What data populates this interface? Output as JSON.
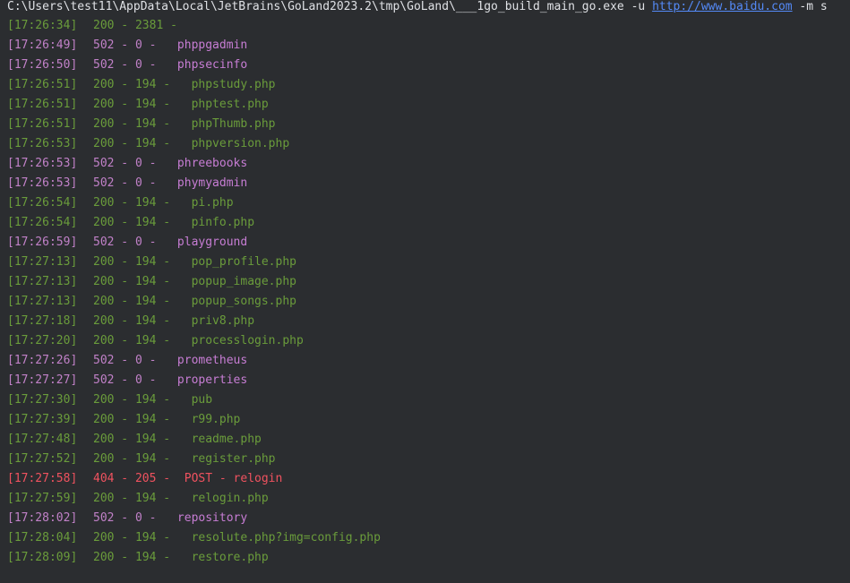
{
  "command": {
    "prefix": "C:\\Users\\test11\\AppData\\Local\\JetBrains\\GoLand2023.2\\tmp\\GoLand\\___1go_build_main_go.exe -u ",
    "url": "http://www.baidu.com",
    "suffix": " -m s"
  },
  "colors": {
    "background": "#2b2d30",
    "ok": "#6a9c3b",
    "bad_gateway": "#c181c8",
    "error": "#f0525f",
    "link": "#548af7"
  },
  "lines": [
    {
      "ts": "[17:26:34]",
      "meta": "200 - 2381 -",
      "path": "",
      "status": "green"
    },
    {
      "ts": "[17:26:49]",
      "meta": "502 - 0 -   ",
      "path": "phppgadmin",
      "status": "purple"
    },
    {
      "ts": "[17:26:50]",
      "meta": "502 - 0 -   ",
      "path": "phpsecinfo",
      "status": "purple"
    },
    {
      "ts": "[17:26:51]",
      "meta": "200 - 194 -   ",
      "path": "phpstudy.php",
      "status": "green"
    },
    {
      "ts": "[17:26:51]",
      "meta": "200 - 194 -   ",
      "path": "phptest.php",
      "status": "green"
    },
    {
      "ts": "[17:26:51]",
      "meta": "200 - 194 -   ",
      "path": "phpThumb.php",
      "status": "green"
    },
    {
      "ts": "[17:26:53]",
      "meta": "200 - 194 -   ",
      "path": "phpversion.php",
      "status": "green"
    },
    {
      "ts": "[17:26:53]",
      "meta": "502 - 0 -   ",
      "path": "phreebooks",
      "status": "purple"
    },
    {
      "ts": "[17:26:53]",
      "meta": "502 - 0 -   ",
      "path": "phymyadmin",
      "status": "purple"
    },
    {
      "ts": "[17:26:54]",
      "meta": "200 - 194 -   ",
      "path": "pi.php",
      "status": "green"
    },
    {
      "ts": "[17:26:54]",
      "meta": "200 - 194 -   ",
      "path": "pinfo.php",
      "status": "green"
    },
    {
      "ts": "[17:26:59]",
      "meta": "502 - 0 -   ",
      "path": "playground",
      "status": "purple"
    },
    {
      "ts": "[17:27:13]",
      "meta": "200 - 194 -   ",
      "path": "pop_profile.php",
      "status": "green"
    },
    {
      "ts": "[17:27:13]",
      "meta": "200 - 194 -   ",
      "path": "popup_image.php",
      "status": "green"
    },
    {
      "ts": "[17:27:13]",
      "meta": "200 - 194 -   ",
      "path": "popup_songs.php",
      "status": "green"
    },
    {
      "ts": "[17:27:18]",
      "meta": "200 - 194 -   ",
      "path": "priv8.php",
      "status": "green"
    },
    {
      "ts": "[17:27:20]",
      "meta": "200 - 194 -   ",
      "path": "processlogin.php",
      "status": "green"
    },
    {
      "ts": "[17:27:26]",
      "meta": "502 - 0 -   ",
      "path": "prometheus",
      "status": "purple"
    },
    {
      "ts": "[17:27:27]",
      "meta": "502 - 0 -   ",
      "path": "properties",
      "status": "purple"
    },
    {
      "ts": "[17:27:30]",
      "meta": "200 - 194 -   ",
      "path": "pub",
      "status": "green"
    },
    {
      "ts": "[17:27:39]",
      "meta": "200 - 194 -   ",
      "path": "r99.php",
      "status": "green"
    },
    {
      "ts": "[17:27:48]",
      "meta": "200 - 194 -   ",
      "path": "readme.php",
      "status": "green"
    },
    {
      "ts": "[17:27:52]",
      "meta": "200 - 194 -   ",
      "path": "register.php",
      "status": "green"
    },
    {
      "ts": "[17:27:58]",
      "meta": "404 - 205 -  ",
      "path": "POST - relogin",
      "status": "red"
    },
    {
      "ts": "[17:27:59]",
      "meta": "200 - 194 -   ",
      "path": "relogin.php",
      "status": "green"
    },
    {
      "ts": "[17:28:02]",
      "meta": "502 - 0 -   ",
      "path": "repository",
      "status": "purple"
    },
    {
      "ts": "[17:28:04]",
      "meta": "200 - 194 -   ",
      "path": "resolute.php?img=config.php",
      "status": "green"
    },
    {
      "ts": "[17:28:09]",
      "meta": "200 - 194 -   ",
      "path": "restore.php",
      "status": "green"
    }
  ]
}
